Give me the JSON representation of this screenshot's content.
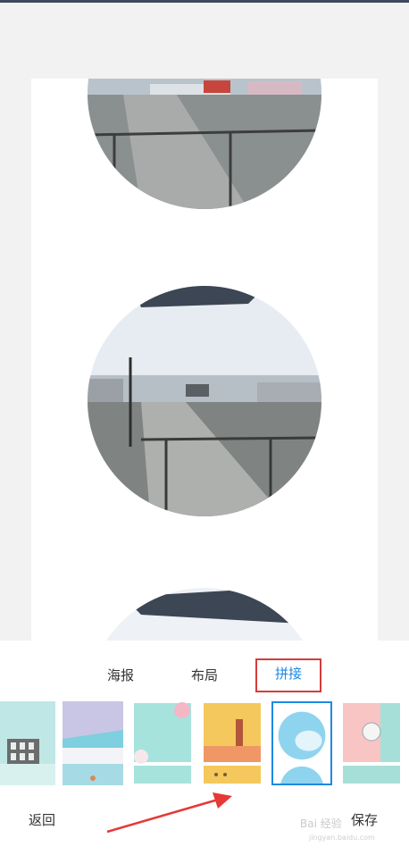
{
  "tabs": {
    "poster": "海报",
    "layout": "布局",
    "splice": "拼接"
  },
  "actions": {
    "back": "返回",
    "save": "保存"
  },
  "watermark": {
    "brand": "Bai 经验",
    "url": "jingyan.baidu.com"
  },
  "colors": {
    "accent": "#1e88e5",
    "highlight": "#d63b3b",
    "arrow": "#e53935"
  }
}
